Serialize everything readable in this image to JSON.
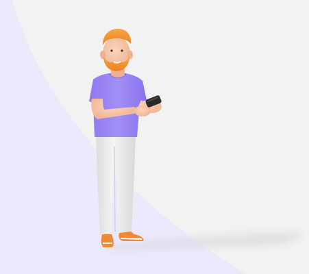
{
  "scene": {
    "colors": {
      "background": "#f2f2f2",
      "accent_panel": "#ede9fd",
      "shirt": "#9b86f4",
      "pants": "#ececec",
      "hair_beard": "#f2922e",
      "skin": "#f6c6a8",
      "shoes": "#ef8a34",
      "phone": "#2a2a2a"
    },
    "illustration": {
      "subject": "person-holding-phone",
      "icon": "person-phone-illustration"
    }
  }
}
